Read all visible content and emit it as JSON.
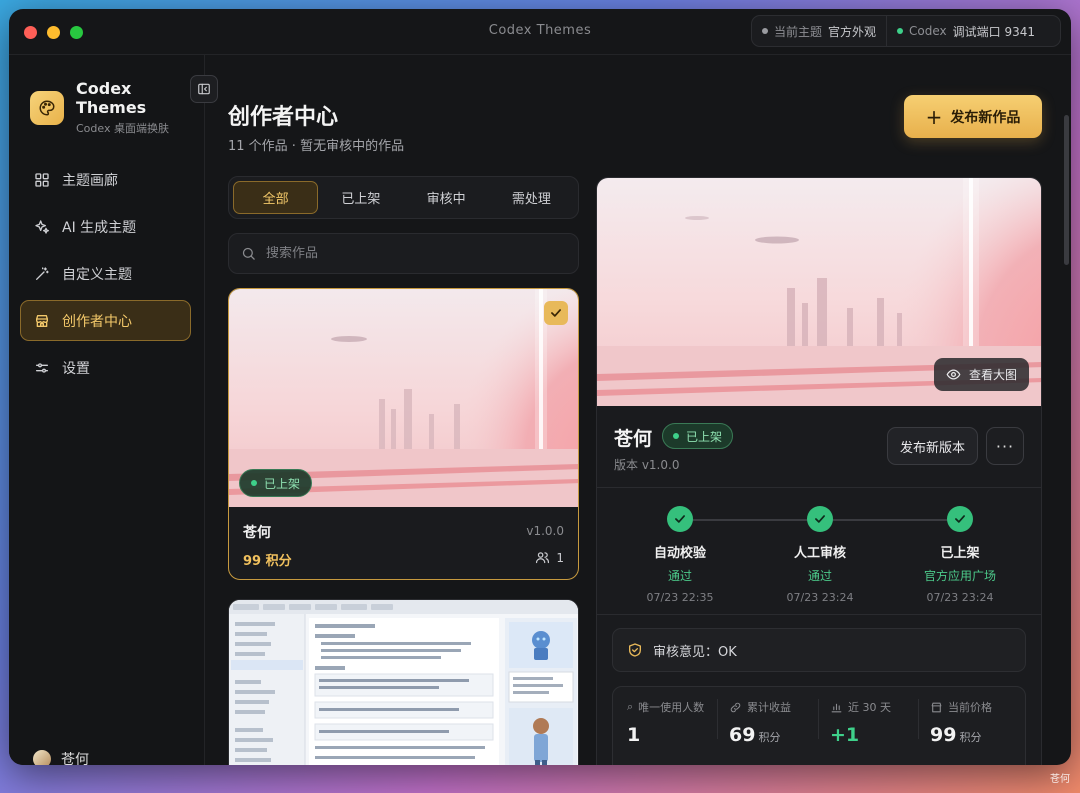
{
  "window": {
    "title": "Codex Themes",
    "status": {
      "current_theme_label": "当前主题",
      "current_theme_value": "官方外观",
      "codex_label": "Codex",
      "debug_port": "调试端口 9341"
    }
  },
  "sidebar": {
    "brand_title": "Codex Themes",
    "brand_subtitle": "Codex 桌面端换肤",
    "items": [
      {
        "label": "主题画廊",
        "icon": "grid-icon"
      },
      {
        "label": "AI 生成主题",
        "icon": "sparkle-icon"
      },
      {
        "label": "自定义主题",
        "icon": "magic-wand-icon"
      },
      {
        "label": "创作者中心",
        "icon": "store-icon",
        "active": true
      },
      {
        "label": "设置",
        "icon": "sliders-icon"
      }
    ],
    "user_name": "苍何"
  },
  "header": {
    "title": "创作者中心",
    "subtitle": "11 个作品 · 暂无审核中的作品",
    "publish_label": "发布新作品"
  },
  "filters": {
    "tabs": [
      "全部",
      "已上架",
      "审核中",
      "需处理"
    ],
    "active": 0,
    "search_placeholder": "搜索作品"
  },
  "works": [
    {
      "name": "苍何",
      "version": "v1.0.0",
      "status": "已上架",
      "points": "99 积分",
      "users": "1",
      "selected": true
    }
  ],
  "detail": {
    "name": "苍何",
    "status": "已上架",
    "version_text": "版本 v1.0.0",
    "view_large_label": "查看大图",
    "new_version_label": "发布新版本",
    "more_label": "···",
    "steps": [
      {
        "title": "自动校验",
        "status": "通过",
        "time": "07/23 22:35"
      },
      {
        "title": "人工审核",
        "status": "通过",
        "time": "07/23 23:24"
      },
      {
        "title": "已上架",
        "status": "官方应用广场",
        "time": "07/23 23:24"
      }
    ],
    "review_label": "审核意见：OK",
    "stats": [
      {
        "label": "唯一使用人数",
        "value": "1",
        "unit": ""
      },
      {
        "label": "累计收益",
        "value": "69",
        "unit": "积分"
      },
      {
        "label": "近 30 天",
        "value": "+1",
        "unit": ""
      },
      {
        "label": "当前价格",
        "value": "99",
        "unit": "积分"
      }
    ]
  },
  "watermark": "苍何",
  "colors": {
    "accent": "#e8b04c",
    "success": "#35c07c",
    "background": "#151618"
  }
}
